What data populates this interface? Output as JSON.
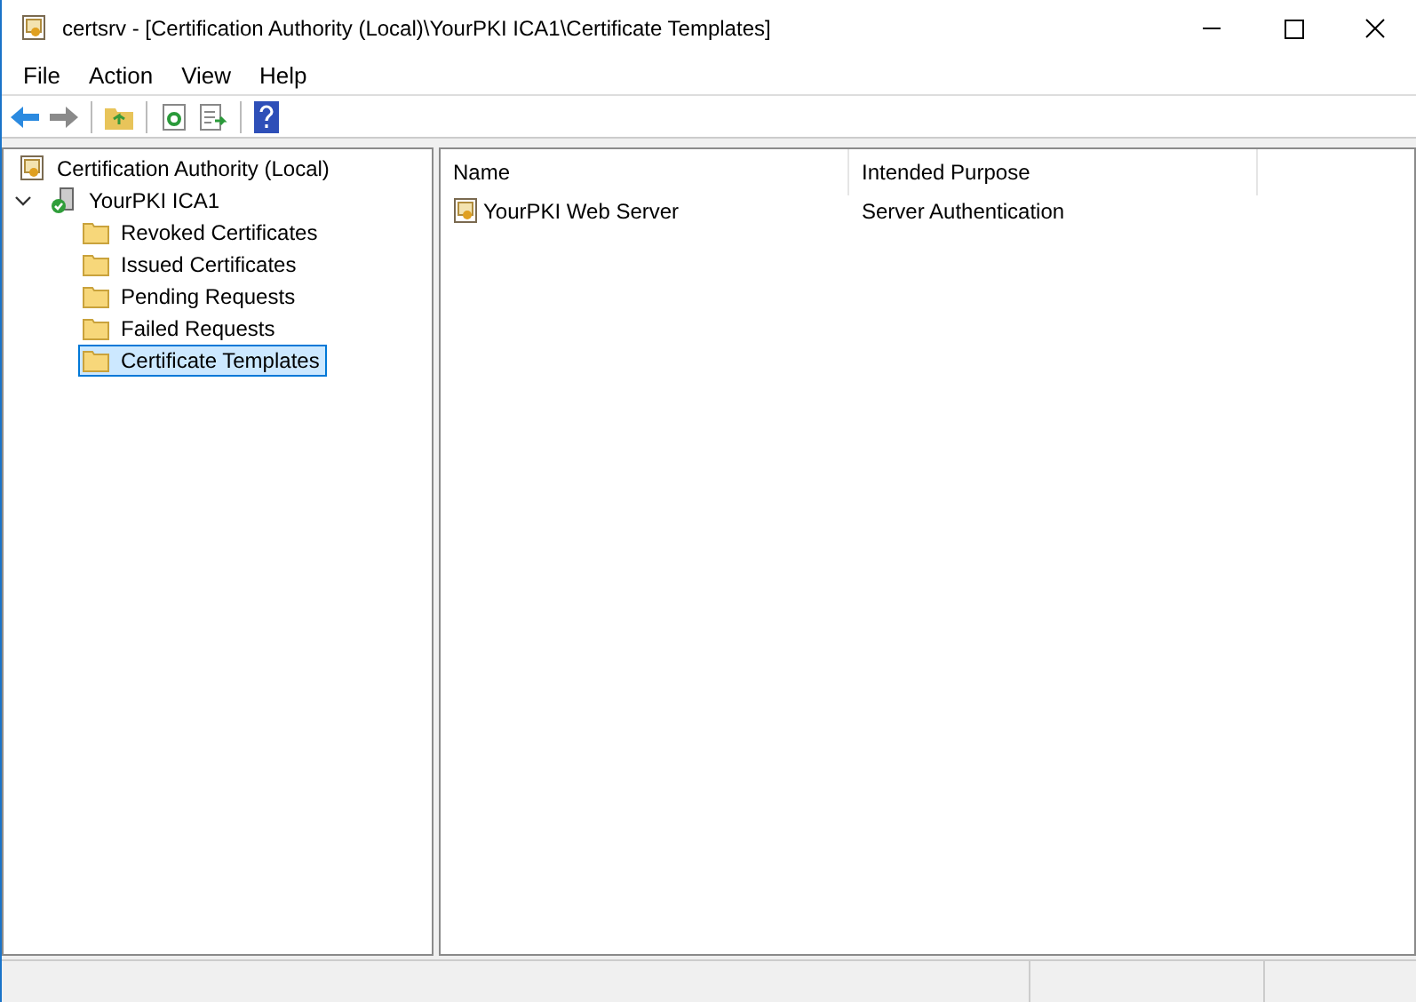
{
  "window": {
    "title": "certsrv - [Certification Authority (Local)\\YourPKI ICA1\\Certificate Templates]"
  },
  "menu": [
    "File",
    "Action",
    "View",
    "Help"
  ],
  "tree": [
    {
      "label": "Certification Authority (Local)",
      "kind": "ca",
      "selected": false,
      "children": [
        {
          "label": "YourPKI ICA1",
          "kind": "server",
          "expanded": true,
          "selected": false,
          "children": [
            {
              "label": "Revoked Certificates",
              "kind": "folder",
              "selected": false
            },
            {
              "label": "Issued Certificates",
              "kind": "folder",
              "selected": false
            },
            {
              "label": "Pending Requests",
              "kind": "folder",
              "selected": false
            },
            {
              "label": "Failed Requests",
              "kind": "folder",
              "selected": false
            },
            {
              "label": "Certificate Templates",
              "kind": "folder",
              "selected": true
            }
          ]
        }
      ]
    }
  ],
  "table": {
    "columns": [
      "Name",
      "Intended Purpose"
    ],
    "rows": [
      {
        "name": "YourPKI Web Server",
        "purpose": "Server Authentication"
      }
    ]
  }
}
